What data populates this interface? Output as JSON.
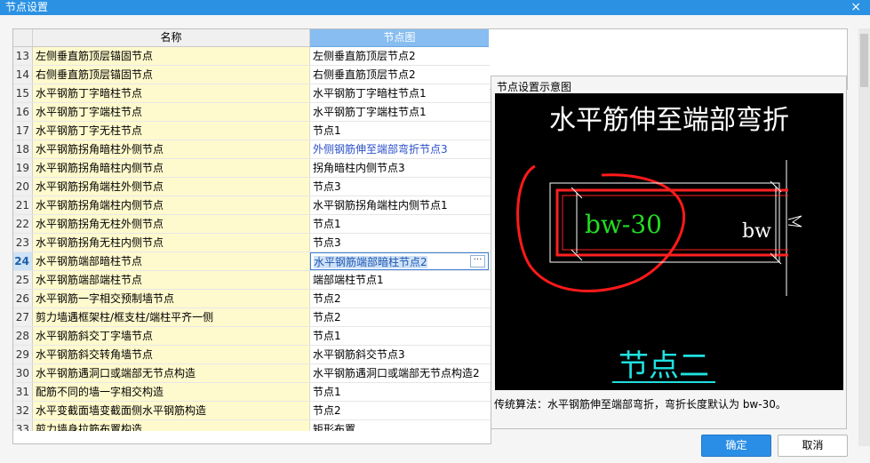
{
  "window": {
    "title": "节点设置",
    "close_icon": "×"
  },
  "grid": {
    "headers": {
      "name": "名称",
      "node": "节点图"
    },
    "rows": [
      {
        "num": "13",
        "name": "左侧垂直筋顶层锚固节点",
        "node": "左侧垂直筋顶层节点2"
      },
      {
        "num": "14",
        "name": "右侧垂直筋顶层锚固节点",
        "node": "右侧垂直筋顶层节点2"
      },
      {
        "num": "15",
        "name": "水平钢筋丁字暗柱节点",
        "node": "水平钢筋丁字暗柱节点1"
      },
      {
        "num": "16",
        "name": "水平钢筋丁字端柱节点",
        "node": "水平钢筋丁字端柱节点1"
      },
      {
        "num": "17",
        "name": "水平钢筋丁字无柱节点",
        "node": "节点1"
      },
      {
        "num": "18",
        "name": "水平钢筋拐角暗柱外侧节点",
        "node": "外侧钢筋伸至端部弯折节点3"
      },
      {
        "num": "19",
        "name": "水平钢筋拐角暗柱内侧节点",
        "node": "拐角暗柱内侧节点3"
      },
      {
        "num": "20",
        "name": "水平钢筋拐角端柱外侧节点",
        "node": "节点3"
      },
      {
        "num": "21",
        "name": "水平钢筋拐角端柱内侧节点",
        "node": "水平钢筋拐角端柱内侧节点1"
      },
      {
        "num": "22",
        "name": "水平钢筋拐角无柱外侧节点",
        "node": "节点1"
      },
      {
        "num": "23",
        "name": "水平钢筋拐角无柱内侧节点",
        "node": "节点3"
      },
      {
        "num": "24",
        "name": "水平钢筋端部暗柱节点",
        "node": "水平钢筋端部暗柱节点2"
      },
      {
        "num": "25",
        "name": "水平钢筋端部端柱节点",
        "node": "端部端柱节点1"
      },
      {
        "num": "26",
        "name": "水平钢筋一字相交预制墙节点",
        "node": "节点2"
      },
      {
        "num": "27",
        "name": "剪力墙遇框架柱/框支柱/端柱平齐一侧",
        "node": "节点2"
      },
      {
        "num": "28",
        "name": "水平钢筋斜交丁字墙节点",
        "node": "节点1"
      },
      {
        "num": "29",
        "name": "水平钢筋斜交转角墙节点",
        "node": "水平钢筋斜交节点3"
      },
      {
        "num": "30",
        "name": "水平钢筋遇洞口或端部无节点构造",
        "node": "水平钢筋遇洞口或端部无节点构造2"
      },
      {
        "num": "31",
        "name": "配筋不同的墙一字相交构造",
        "node": "节点1"
      },
      {
        "num": "32",
        "name": "水平变截面墙变截面侧水平钢筋构造",
        "node": "节点2"
      },
      {
        "num": "33",
        "name": "剪力墙身拉筋布置构造",
        "node": "矩形布置"
      }
    ],
    "selected_row": "24",
    "ellipsis_label": "···"
  },
  "preview": {
    "title": "节点设置示意图",
    "diagram_heading": "水平筋伸至端部弯折",
    "dim_left": "bw-30",
    "dim_right": "bw",
    "node_label": "节点二",
    "description": "传统算法：水平钢筋伸至端部弯折，弯折长度默认为 bw-30。"
  },
  "buttons": {
    "ok": "确定",
    "cancel": "取消"
  },
  "colors": {
    "titlebar": "#2b91e3",
    "header_selected": "#87bdf0",
    "name_cell": "#fffacd",
    "ok_button": "#2b8ee6"
  }
}
